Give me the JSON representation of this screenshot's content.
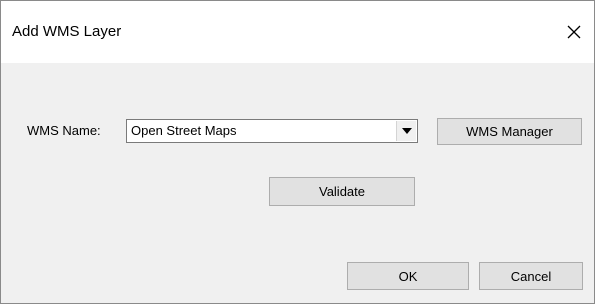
{
  "dialog": {
    "title": "Add WMS Layer",
    "close_icon": "close-icon"
  },
  "form": {
    "wms_name_label": "WMS Name:",
    "wms_name_value": "Open Street Maps",
    "dropdown_icon": "chevron-down-icon",
    "wms_manager_label": "WMS Manager",
    "validate_label": "Validate"
  },
  "footer": {
    "ok_label": "OK",
    "cancel_label": "Cancel"
  },
  "colors": {
    "title_bar": "#ffffff",
    "body": "#f0f0f0",
    "button_face": "#e1e1e1",
    "button_border": "#adadad"
  }
}
